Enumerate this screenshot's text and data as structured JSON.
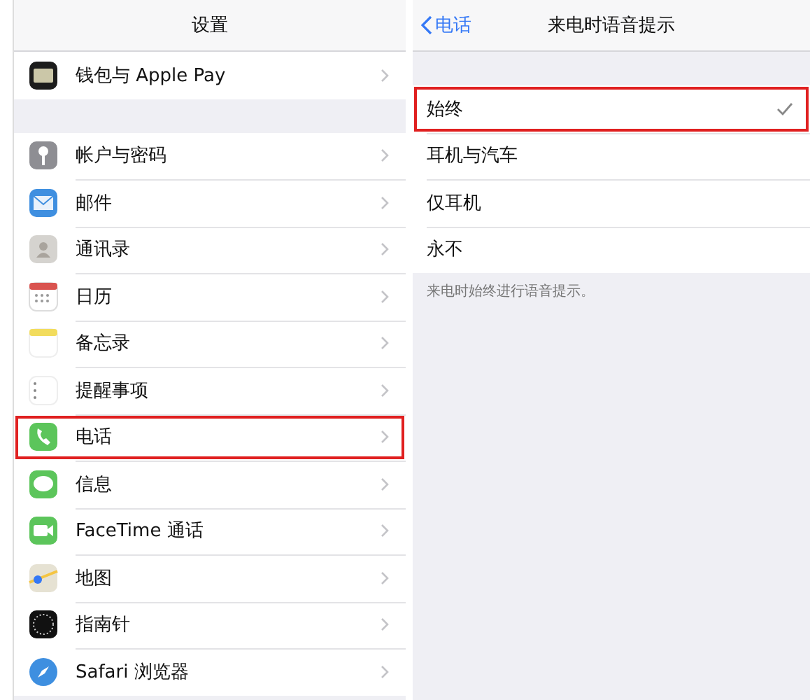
{
  "settings": {
    "title": "设置",
    "groups": [
      [
        {
          "label": "钱包与 Apple Pay",
          "highlighted": false
        }
      ],
      [
        {
          "label": "帐户与密码",
          "highlighted": false
        },
        {
          "label": "邮件",
          "highlighted": false
        },
        {
          "label": "通讯录",
          "highlighted": false
        },
        {
          "label": "日历",
          "highlighted": false
        },
        {
          "label": "备忘录",
          "highlighted": false
        },
        {
          "label": "提醒事项",
          "highlighted": false
        },
        {
          "label": "电话",
          "highlighted": true
        },
        {
          "label": "信息",
          "highlighted": false
        },
        {
          "label": "FaceTime 通话",
          "highlighted": false
        },
        {
          "label": "地图",
          "highlighted": false
        },
        {
          "label": "指南针",
          "highlighted": false
        },
        {
          "label": "Safari 浏览器",
          "highlighted": false
        }
      ]
    ]
  },
  "announce": {
    "back": "电话",
    "title": "来电时语音提示",
    "options": [
      {
        "label": "始终",
        "selected": true,
        "highlighted": true
      },
      {
        "label": "耳机与汽车",
        "selected": false,
        "highlighted": false
      },
      {
        "label": "仅耳机",
        "selected": false,
        "highlighted": false
      },
      {
        "label": "永不",
        "selected": false,
        "highlighted": false
      }
    ],
    "footnote": "来电时始终进行语音提示。"
  }
}
